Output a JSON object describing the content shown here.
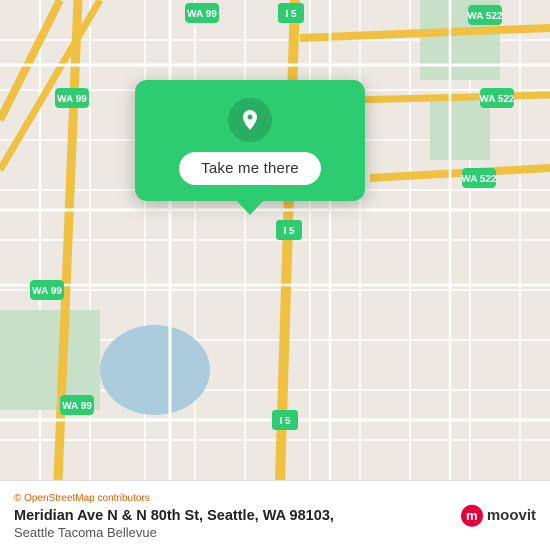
{
  "map": {
    "attribution": "© OpenStreetMap contributors",
    "colors": {
      "road_major": "#f5d76e",
      "road_minor": "#ffffff",
      "highway": "#f5d76e",
      "water": "#b0d4e8",
      "park": "#c8dfc8",
      "land": "#e8e0d8",
      "grid": "#d8cfc8"
    },
    "highway_labels": [
      "WA 99",
      "WA 99",
      "WA 99",
      "WA 99",
      "WA 522",
      "WA 522",
      "WA 522",
      "I 5",
      "I 5",
      "I 5"
    ]
  },
  "popup": {
    "button_label": "Take me there",
    "pin_icon": "📍",
    "background_color": "#2ecc71"
  },
  "bottom_bar": {
    "attribution": "© OpenStreetMap contributors",
    "address": "Meridian Ave N & N 80th St, Seattle, WA 98103,",
    "region": "Seattle Tacoma Bellevue"
  },
  "moovit": {
    "label": "moovit"
  }
}
